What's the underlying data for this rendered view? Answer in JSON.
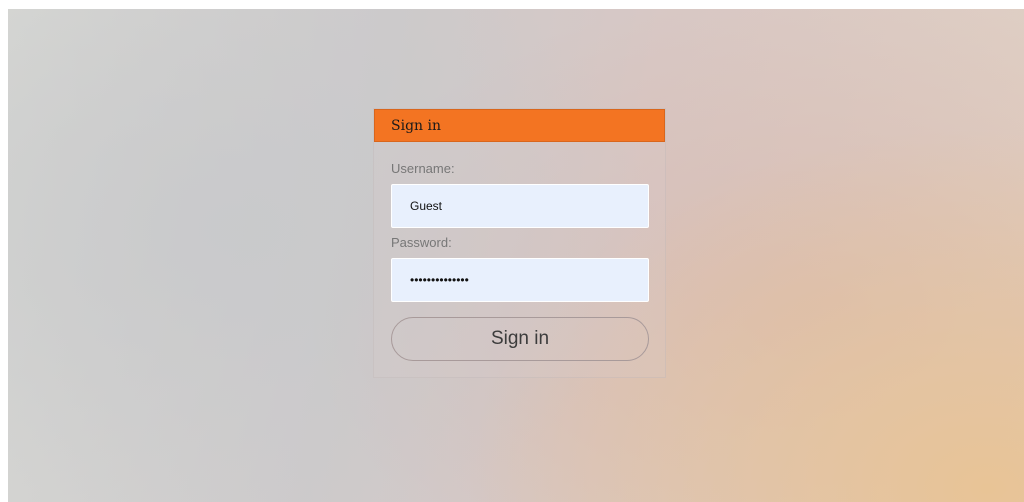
{
  "panel": {
    "title": "Sign in"
  },
  "form": {
    "username_label": "Username:",
    "username_value": "Guest",
    "password_label": "Password:",
    "password_value": "••••••••••••••",
    "submit_label": "Sign in"
  },
  "colors": {
    "header_accent": "#f37422",
    "input_background": "#e8f0fd"
  }
}
